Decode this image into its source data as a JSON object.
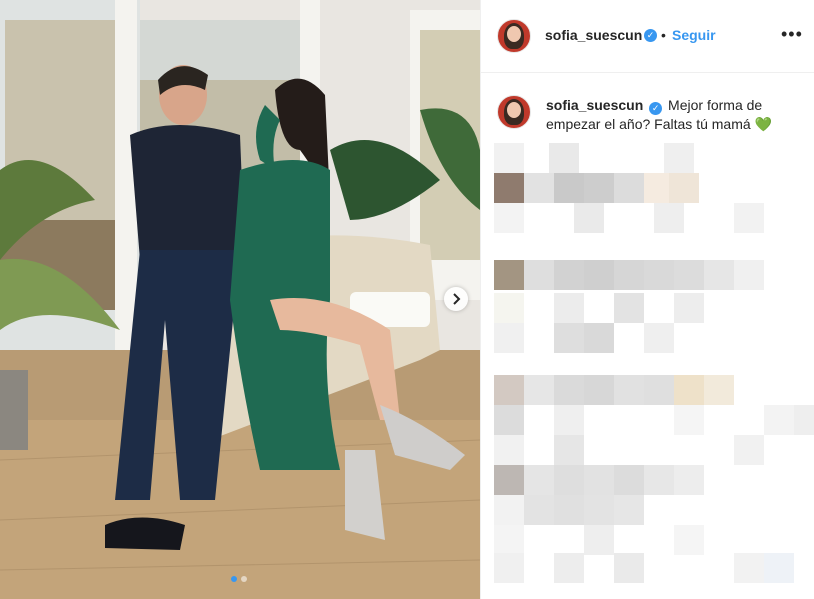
{
  "post": {
    "username": "sofia_suescun",
    "bullet": "•",
    "follow_label": "Seguir",
    "more_label": "•••",
    "caption_username": "sofia_suescun",
    "caption_text": "Mejor forma de empezar el año? Faltas tú mamá",
    "caption_emoji": "💚",
    "verified_glyph": "✓"
  },
  "carousel": {
    "current": 1,
    "total": 2
  },
  "icons": {
    "verified": "verified-badge-icon",
    "more": "more-options-icon",
    "next": "chevron-right-icon"
  },
  "colors": {
    "link_blue": "#3897f0",
    "text": "#262626",
    "border": "#efefef"
  }
}
